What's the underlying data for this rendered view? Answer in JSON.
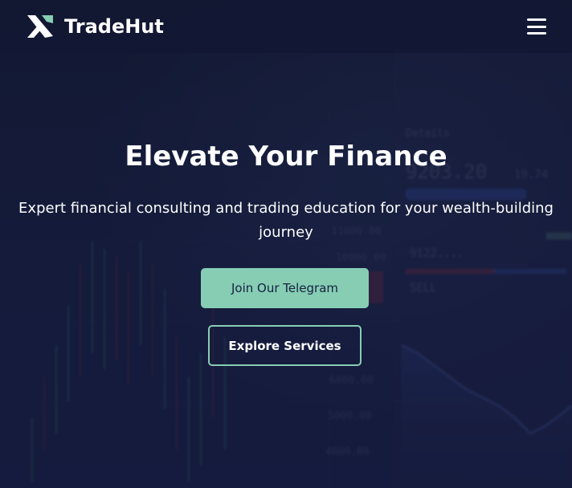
{
  "navbar": {
    "brand_name": "TradeHut",
    "logo_icon": "tradehut-x-logo-icon",
    "menu_icon": "hamburger-menu-icon"
  },
  "hero": {
    "headline": "Elevate Your Finance",
    "subtitle": "Expert financial consulting and trading education for your wealth-building journey",
    "primary_button_label": "Join Our Telegram",
    "secondary_button_label": "Explore Services"
  },
  "colors": {
    "background": "#141a33",
    "accent": "#86cdb4",
    "text": "#ffffff",
    "button_text_dark": "#16203d"
  }
}
